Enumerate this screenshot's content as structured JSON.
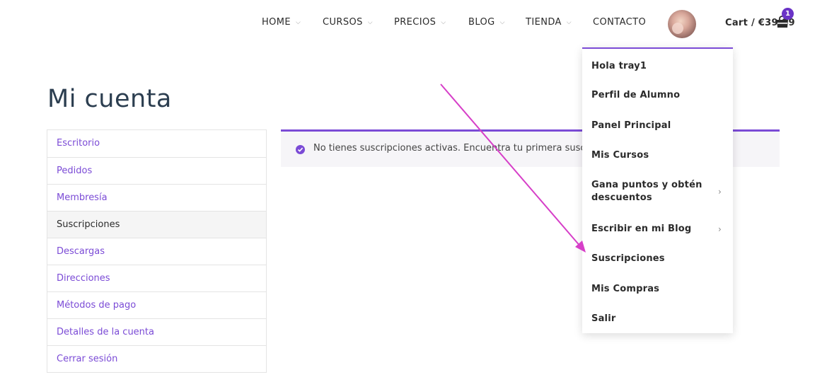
{
  "nav": {
    "items": [
      {
        "label": "HOME",
        "chevron": true
      },
      {
        "label": "CURSOS",
        "chevron": true
      },
      {
        "label": "PRECIOS",
        "chevron": true
      },
      {
        "label": "BLOG",
        "chevron": true
      },
      {
        "label": "TIENDA",
        "chevron": true
      },
      {
        "label": "CONTACTO",
        "chevron": false
      }
    ],
    "chevron_glyph": "⌵",
    "cart_label": "Cart / €39.99",
    "cart_count": "1"
  },
  "page": {
    "title": "Mi cuenta"
  },
  "account_nav": {
    "items": [
      {
        "label": "Escritorio"
      },
      {
        "label": "Pedidos"
      },
      {
        "label": "Membresía"
      },
      {
        "label": "Suscripciones",
        "active": true
      },
      {
        "label": "Descargas"
      },
      {
        "label": "Direcciones"
      },
      {
        "label": "Métodos de pago"
      },
      {
        "label": "Detalles de la cuenta"
      },
      {
        "label": "Cerrar sesión"
      }
    ]
  },
  "notice": {
    "text": "No tienes suscripciones activas. Encuentra tu primera suscripción en la tienda."
  },
  "dropdown": {
    "items": [
      {
        "label": "Hola tray1",
        "submenu": false
      },
      {
        "label": "Perfil de Alumno",
        "submenu": false
      },
      {
        "label": "Panel Principal",
        "submenu": false
      },
      {
        "label": "Mis Cursos",
        "submenu": false
      },
      {
        "label": "Gana puntos y obtén descuentos",
        "submenu": true
      },
      {
        "label": "Escribir en mi Blog",
        "submenu": true
      },
      {
        "label": "Suscripciones",
        "submenu": false
      },
      {
        "label": "Mis Compras",
        "submenu": false
      },
      {
        "label": "Salir",
        "submenu": false
      }
    ],
    "submenu_glyph": "›"
  },
  "colors": {
    "accent": "#7b4bd6",
    "badge": "#6a33c6",
    "annotation_arrow": "#d63fc8"
  }
}
